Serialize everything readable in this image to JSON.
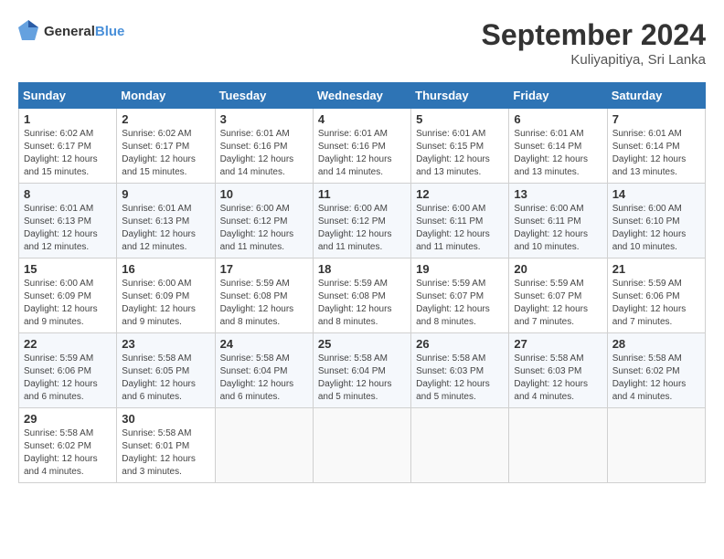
{
  "header": {
    "logo_general": "General",
    "logo_blue": "Blue",
    "month_title": "September 2024",
    "location": "Kuliyapitiya, Sri Lanka"
  },
  "weekdays": [
    "Sunday",
    "Monday",
    "Tuesday",
    "Wednesday",
    "Thursday",
    "Friday",
    "Saturday"
  ],
  "weeks": [
    [
      {
        "day": "1",
        "sunrise": "6:02 AM",
        "sunset": "6:17 PM",
        "daylight": "12 hours and 15 minutes."
      },
      {
        "day": "2",
        "sunrise": "6:02 AM",
        "sunset": "6:17 PM",
        "daylight": "12 hours and 15 minutes."
      },
      {
        "day": "3",
        "sunrise": "6:01 AM",
        "sunset": "6:16 PM",
        "daylight": "12 hours and 14 minutes."
      },
      {
        "day": "4",
        "sunrise": "6:01 AM",
        "sunset": "6:16 PM",
        "daylight": "12 hours and 14 minutes."
      },
      {
        "day": "5",
        "sunrise": "6:01 AM",
        "sunset": "6:15 PM",
        "daylight": "12 hours and 13 minutes."
      },
      {
        "day": "6",
        "sunrise": "6:01 AM",
        "sunset": "6:14 PM",
        "daylight": "12 hours and 13 minutes."
      },
      {
        "day": "7",
        "sunrise": "6:01 AM",
        "sunset": "6:14 PM",
        "daylight": "12 hours and 13 minutes."
      }
    ],
    [
      {
        "day": "8",
        "sunrise": "6:01 AM",
        "sunset": "6:13 PM",
        "daylight": "12 hours and 12 minutes."
      },
      {
        "day": "9",
        "sunrise": "6:01 AM",
        "sunset": "6:13 PM",
        "daylight": "12 hours and 12 minutes."
      },
      {
        "day": "10",
        "sunrise": "6:00 AM",
        "sunset": "6:12 PM",
        "daylight": "12 hours and 11 minutes."
      },
      {
        "day": "11",
        "sunrise": "6:00 AM",
        "sunset": "6:12 PM",
        "daylight": "12 hours and 11 minutes."
      },
      {
        "day": "12",
        "sunrise": "6:00 AM",
        "sunset": "6:11 PM",
        "daylight": "12 hours and 11 minutes."
      },
      {
        "day": "13",
        "sunrise": "6:00 AM",
        "sunset": "6:11 PM",
        "daylight": "12 hours and 10 minutes."
      },
      {
        "day": "14",
        "sunrise": "6:00 AM",
        "sunset": "6:10 PM",
        "daylight": "12 hours and 10 minutes."
      }
    ],
    [
      {
        "day": "15",
        "sunrise": "6:00 AM",
        "sunset": "6:09 PM",
        "daylight": "12 hours and 9 minutes."
      },
      {
        "day": "16",
        "sunrise": "6:00 AM",
        "sunset": "6:09 PM",
        "daylight": "12 hours and 9 minutes."
      },
      {
        "day": "17",
        "sunrise": "5:59 AM",
        "sunset": "6:08 PM",
        "daylight": "12 hours and 8 minutes."
      },
      {
        "day": "18",
        "sunrise": "5:59 AM",
        "sunset": "6:08 PM",
        "daylight": "12 hours and 8 minutes."
      },
      {
        "day": "19",
        "sunrise": "5:59 AM",
        "sunset": "6:07 PM",
        "daylight": "12 hours and 8 minutes."
      },
      {
        "day": "20",
        "sunrise": "5:59 AM",
        "sunset": "6:07 PM",
        "daylight": "12 hours and 7 minutes."
      },
      {
        "day": "21",
        "sunrise": "5:59 AM",
        "sunset": "6:06 PM",
        "daylight": "12 hours and 7 minutes."
      }
    ],
    [
      {
        "day": "22",
        "sunrise": "5:59 AM",
        "sunset": "6:06 PM",
        "daylight": "12 hours and 6 minutes."
      },
      {
        "day": "23",
        "sunrise": "5:58 AM",
        "sunset": "6:05 PM",
        "daylight": "12 hours and 6 minutes."
      },
      {
        "day": "24",
        "sunrise": "5:58 AM",
        "sunset": "6:04 PM",
        "daylight": "12 hours and 6 minutes."
      },
      {
        "day": "25",
        "sunrise": "5:58 AM",
        "sunset": "6:04 PM",
        "daylight": "12 hours and 5 minutes."
      },
      {
        "day": "26",
        "sunrise": "5:58 AM",
        "sunset": "6:03 PM",
        "daylight": "12 hours and 5 minutes."
      },
      {
        "day": "27",
        "sunrise": "5:58 AM",
        "sunset": "6:03 PM",
        "daylight": "12 hours and 4 minutes."
      },
      {
        "day": "28",
        "sunrise": "5:58 AM",
        "sunset": "6:02 PM",
        "daylight": "12 hours and 4 minutes."
      }
    ],
    [
      {
        "day": "29",
        "sunrise": "5:58 AM",
        "sunset": "6:02 PM",
        "daylight": "12 hours and 4 minutes."
      },
      {
        "day": "30",
        "sunrise": "5:58 AM",
        "sunset": "6:01 PM",
        "daylight": "12 hours and 3 minutes."
      },
      null,
      null,
      null,
      null,
      null
    ]
  ],
  "labels": {
    "sunrise": "Sunrise:",
    "sunset": "Sunset:",
    "daylight": "Daylight:"
  }
}
